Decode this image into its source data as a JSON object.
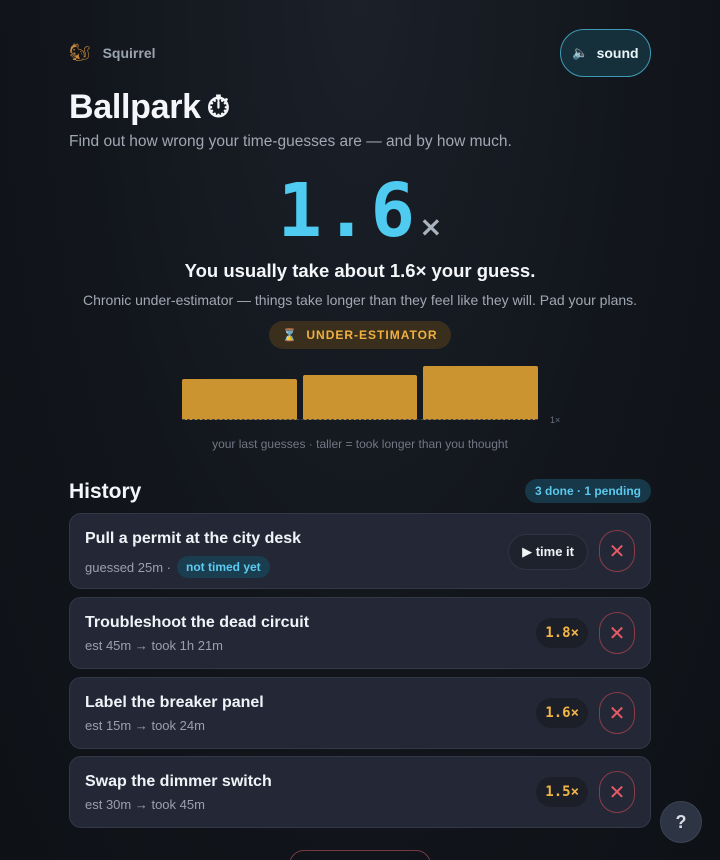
{
  "brand": {
    "icon": "squirrel-icon",
    "glyph": "🐿",
    "name": "Squirrel"
  },
  "sound_button": {
    "icon": "speaker-icon",
    "glyph": "🔈",
    "label": "sound"
  },
  "header": {
    "title": "Ballpark",
    "title_icon": "stopwatch-icon",
    "title_glyph": "⏱",
    "subtitle": "Find out how wrong your time-guesses are — and by how much."
  },
  "summary": {
    "ratio": "1.6",
    "ratio_suffix": "×",
    "headline": "You usually take about 1.6× your guess.",
    "description": "Chronic under-estimator — things take longer than they feel like they will. Pad your plans.",
    "badge_icon": "hourglass-icon",
    "badge_glyph": "⌛",
    "badge_label": "UNDER-ESTIMATOR",
    "colors": {
      "accent": "#4fcaf0",
      "warning": "#f0b040",
      "bar": "#cc9431"
    }
  },
  "chart_data": {
    "type": "bar",
    "values": [
      1.5,
      1.6,
      1.8
    ],
    "baseline_label": "1×",
    "caption": "your last guesses · taller = took longer than you thought"
  },
  "history": {
    "title": "History",
    "count_label": "3 done · 1 pending",
    "items": [
      {
        "title": "Pull a permit at the city desk",
        "meta": "guessed 25m ·",
        "status": "not timed yet",
        "action_label": "▶ time it"
      },
      {
        "title": "Troubleshoot the dead circuit",
        "meta": "est 45m → took 1h 21m",
        "ratio": "1.8×"
      },
      {
        "title": "Label the breaker panel",
        "meta": "est 15m → took 24m",
        "ratio": "1.6×"
      },
      {
        "title": "Swap the dimmer switch",
        "meta": "est 30m → took 45m",
        "ratio": "1.5×"
      }
    ],
    "delete_glyph": "✕"
  },
  "help": {
    "label": "?"
  }
}
